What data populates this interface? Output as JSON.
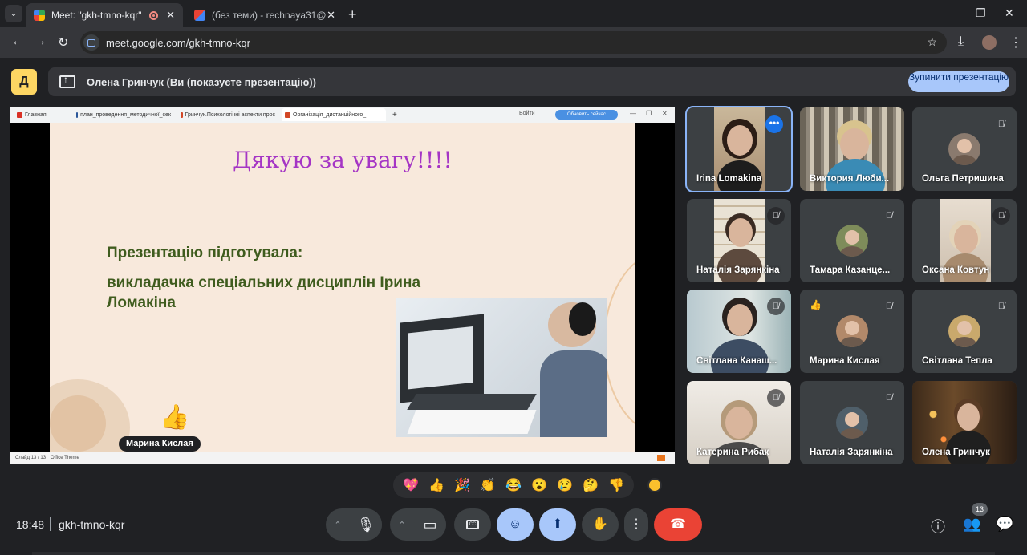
{
  "browser": {
    "tabs": [
      {
        "title": "Meet: \"gkh-tmno-kqr\"",
        "active": true
      },
      {
        "title": "(без теми) - rechnaya31@gmail",
        "active": false
      }
    ],
    "url": "meet.google.com/gkh-tmno-kqr"
  },
  "banner": {
    "text": "Олена Гринчук (Ви (показуєте презентацію))",
    "stop_label": "Зупинити презентацію"
  },
  "presentation": {
    "inner_tabs": [
      "Главная",
      "план_проведення_методичної_сек",
      "Гринчук.Психологічні аспекти прос",
      "Організація_дистанційного_"
    ],
    "login_label": "Войти",
    "update_label": "Обновить сейчас",
    "slide_title": "Дякую за увагу!!!!",
    "slide_subtitle": "Презентацію підготувала:",
    "slide_author": "викладачка спеціальних дисциплін Ірина Ломакіна",
    "reaction_name": "Марина Кислая",
    "status_slide": "Слайд 13 / 13",
    "status_theme": "Office Theme"
  },
  "participants": [
    {
      "name": "Irina Lomakina",
      "muted": false,
      "active": true
    },
    {
      "name": "Виктория Люби...",
      "muted": false
    },
    {
      "name": "Ольга Петришина",
      "muted": true
    },
    {
      "name": "Наталія Зарянкіна",
      "muted": true
    },
    {
      "name": "Тамара Казанце...",
      "muted": true
    },
    {
      "name": "Оксана Ковтун",
      "muted": true
    },
    {
      "name": "Світлана Канаш...",
      "muted": true
    },
    {
      "name": "Марина Кислая",
      "muted": true,
      "reaction": "👍"
    },
    {
      "name": "Світлана Тепла",
      "muted": true
    },
    {
      "name": "Катерина Рибак",
      "muted": true
    },
    {
      "name": "Наталія Зарянкіна",
      "muted": true
    },
    {
      "name": "Олена Гринчук",
      "muted": false
    }
  ],
  "reactions": [
    "💖",
    "👍",
    "🎉",
    "👏",
    "😂",
    "😮",
    "😢",
    "🤔",
    "👎"
  ],
  "footer": {
    "time": "18:48",
    "meeting_code": "gkh-tmno-kqr",
    "participant_count": "13"
  },
  "colors": {
    "accent": "#a8c7fa",
    "end_call": "#ea4335",
    "slide_title": "#a535c5",
    "slide_text": "#3f5c1e"
  }
}
